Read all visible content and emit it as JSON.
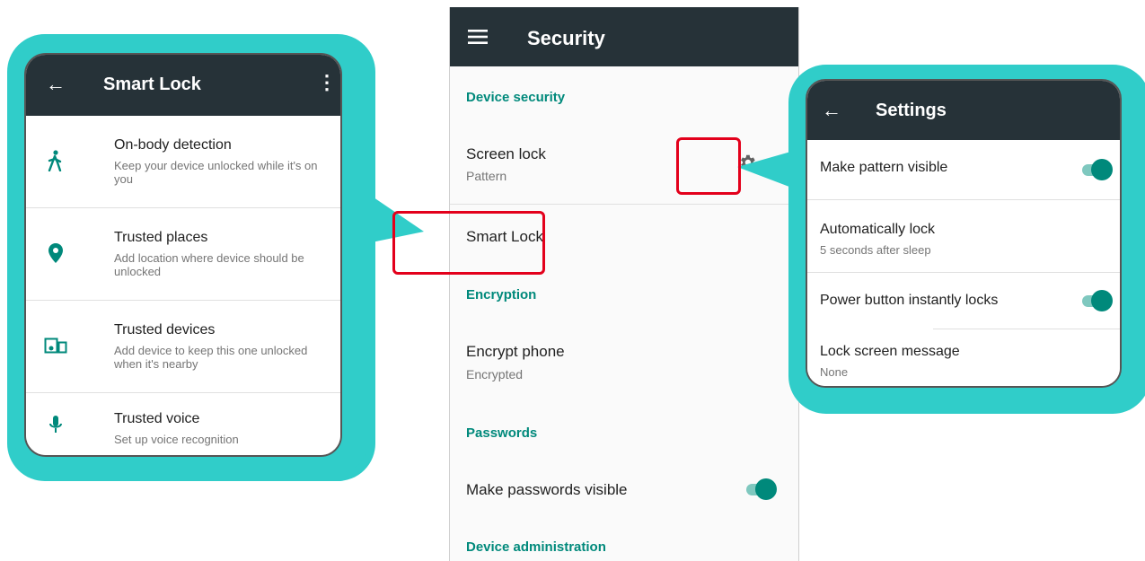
{
  "security": {
    "title": "Security",
    "sections": {
      "device_security": "Device security",
      "encryption": "Encryption",
      "passwords": "Passwords",
      "device_admin": "Device administration"
    },
    "screen_lock": {
      "title": "Screen lock",
      "sub": "Pattern"
    },
    "smart_lock": {
      "title": "Smart Lock"
    },
    "encrypt_phone": {
      "title": "Encrypt phone",
      "sub": "Encrypted"
    },
    "make_passwords_visible": {
      "title": "Make passwords visible",
      "on": true
    }
  },
  "smart_lock_panel": {
    "title": "Smart Lock",
    "items": [
      {
        "title": "On-body detection",
        "sub": "Keep your device unlocked while it's on you",
        "icon": "walk-icon"
      },
      {
        "title": "Trusted places",
        "sub": "Add location where device should be unlocked",
        "icon": "location-pin-icon"
      },
      {
        "title": "Trusted devices",
        "sub": "Add device to keep this one unlocked when it's nearby",
        "icon": "devices-icon"
      },
      {
        "title": "Trusted voice",
        "sub": "Set up voice recognition",
        "icon": "mic-icon"
      }
    ]
  },
  "settings_panel": {
    "title": "Settings",
    "items": [
      {
        "title": "Make pattern visible",
        "toggle": true
      },
      {
        "title": "Automatically lock",
        "sub": "5 seconds after sleep"
      },
      {
        "title": "Power button instantly locks",
        "toggle": true
      },
      {
        "title": "Lock screen message",
        "sub": "None"
      }
    ]
  },
  "colors": {
    "toolbar": "#263238",
    "accent": "#00897b",
    "callout": "#30cdc9",
    "highlight": "#e3001b"
  }
}
